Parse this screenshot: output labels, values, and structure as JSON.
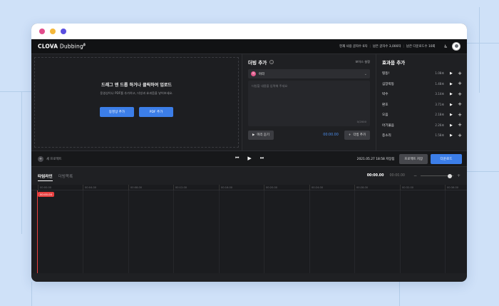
{
  "colors": {
    "background": "#cfe1f8",
    "accent_blue": "#3c7ee8",
    "playhead_red": "#e94040",
    "dot_pink": "#e24d8c",
    "dot_yellow": "#f4b73a",
    "dot_purple": "#5b4fe0"
  },
  "topbar": {
    "logo_bold": "CLOVA",
    "logo_light": " Dubbing",
    "logo_sup": "β",
    "stats": [
      "현재 사용 글자수 0자",
      "남은 글자수 3,000자",
      "남은 다운로드수 10회"
    ],
    "icons": [
      "accessibility-icon",
      "avatar"
    ]
  },
  "upload": {
    "title": "드래그 앤 드롭 하거나 클릭하여 업로드",
    "subtitle": "동영상이나 PDF를 추가하고, 더빙과 효과음을 넣어보세요.",
    "video_button": "동영상 추가",
    "pdf_button": "PDF 추가"
  },
  "dubbing": {
    "title": "더빙 추가",
    "settings_label": "보이스 설정",
    "voice_initial": "아",
    "voice_name": "아라",
    "placeholder": "더빙할 내용을 입력해 주세요",
    "char_count": "0/2000",
    "preview_button": "미리 듣기",
    "time": "00:00.00",
    "add_button": "더빙 추가"
  },
  "sfx": {
    "title": "효과음 추가",
    "items": [
      {
        "name": "띵동!",
        "duration": "1.08초"
      },
      {
        "name": "심장박동",
        "duration": "1.48초"
      },
      {
        "name": "박수",
        "duration": "3.14초"
      },
      {
        "name": "환호",
        "duration": "3.71초"
      },
      {
        "name": "오음",
        "duration": "2.18초"
      },
      {
        "name": "아기울음",
        "duration": "2.26초"
      },
      {
        "name": "종소리",
        "duration": "1.58초"
      }
    ]
  },
  "controls": {
    "new_project": "새 프로젝트",
    "saved_at": "2021.05.27 18:58 저장됨",
    "save_button": "프로젝트 저장",
    "download_button": "다운로드"
  },
  "timeline": {
    "tabs": [
      "타임라인",
      "더빙목록"
    ],
    "current_time": "00:00.00",
    "total_time": "00:00.00",
    "ruler": [
      "00:00.00",
      "00:04.00",
      "00:08.00",
      "00:12.00",
      "00:16.00",
      "00:20.00",
      "00:24.00",
      "00:28.00",
      "00:32.00",
      "00:36.00"
    ],
    "playhead_label": "00:00.00"
  }
}
